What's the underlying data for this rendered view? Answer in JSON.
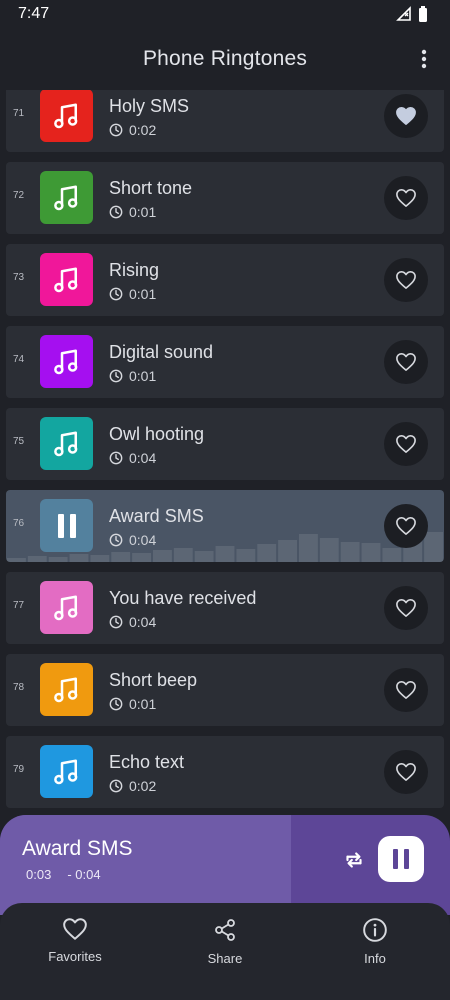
{
  "status_bar": {
    "time": "7:47"
  },
  "app_bar": {
    "title": "Phone Ringtones",
    "menu_icon": "more-vert-icon"
  },
  "ringtones": [
    {
      "number": "71",
      "title": "Holy SMS",
      "duration": "0:02",
      "color": "#e5231d",
      "favorite": true
    },
    {
      "number": "72",
      "title": "Short tone",
      "duration": "0:01",
      "color": "#3e9a35",
      "favorite": false
    },
    {
      "number": "73",
      "title": "Rising",
      "duration": "0:01",
      "color": "#f0179a",
      "favorite": false
    },
    {
      "number": "74",
      "title": "Digital sound",
      "duration": "0:01",
      "color": "#a50ff0",
      "favorite": false
    },
    {
      "number": "75",
      "title": "Owl hooting",
      "duration": "0:04",
      "color": "#13a6a0",
      "favorite": false
    },
    {
      "number": "76",
      "title": "Award SMS",
      "duration": "0:04",
      "color": "#53819e",
      "favorite": false,
      "playing": true
    },
    {
      "number": "77",
      "title": "You have received",
      "duration": "0:04",
      "color": "#e36cc3",
      "favorite": false
    },
    {
      "number": "78",
      "title": "Short beep",
      "duration": "0:01",
      "color": "#f09a0f",
      "favorite": false
    },
    {
      "number": "79",
      "title": "Echo text",
      "duration": "0:02",
      "color": "#1f98e0",
      "favorite": false
    }
  ],
  "player": {
    "title": "Award SMS",
    "elapsed": "0:03",
    "remaining": "- 0:04",
    "progress": 0.75,
    "accent": "#5d4697"
  },
  "bottom_nav": [
    {
      "label": "Favorites",
      "icon": "heart-icon"
    },
    {
      "label": "Share",
      "icon": "share-icon"
    },
    {
      "label": "Info",
      "icon": "info-icon"
    }
  ]
}
